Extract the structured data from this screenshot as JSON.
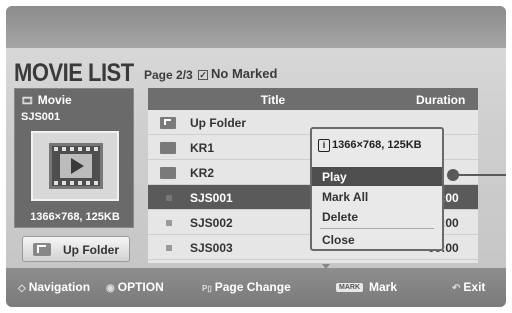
{
  "header": {
    "title": "MOVIE LIST",
    "page": "Page 2/3",
    "marked": "No Marked"
  },
  "preview": {
    "label": "Movie",
    "name": "SJS001",
    "info": "1366×768, 125KB",
    "icon": "film-play-icon"
  },
  "up_folder_button": {
    "label": "Up Folder",
    "icon": "up-folder-icon"
  },
  "list": {
    "columns": [
      "Title",
      "Duration"
    ],
    "rows": [
      {
        "name": "Up Folder",
        "type": "up-folder",
        "duration": ""
      },
      {
        "name": "KR1",
        "type": "folder",
        "duration": ""
      },
      {
        "name": "KR2",
        "type": "folder",
        "duration": ""
      },
      {
        "name": "SJS001",
        "type": "file",
        "duration": "00:00",
        "selected": true
      },
      {
        "name": "SJS002",
        "type": "file",
        "duration": "00:00"
      },
      {
        "name": "SJS003",
        "type": "file",
        "duration": "00:00"
      }
    ]
  },
  "popup": {
    "info": "1366×768, 125KB",
    "items": [
      "Play",
      "Mark All",
      "Delete",
      "Close"
    ],
    "active": "Play"
  },
  "footer": {
    "navigation": "Navigation",
    "option": "OPTION",
    "page_change": "Page Change",
    "mark_key": "MARK",
    "mark": "Mark",
    "exit": "Exit"
  },
  "colors": {
    "accent_dark": "#5a5a5a",
    "header_bar": "#6e6e6e",
    "footer_bar": "#8a8a8a"
  }
}
